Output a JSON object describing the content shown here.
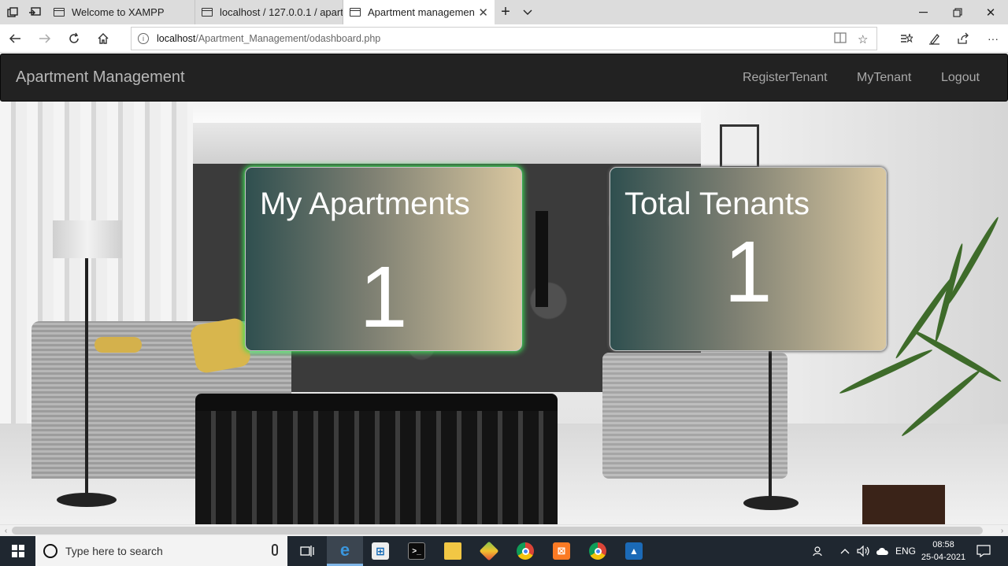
{
  "browser": {
    "tabs": [
      {
        "title": "Welcome to XAMPP",
        "active": false
      },
      {
        "title": "localhost / 127.0.0.1 / aparti",
        "active": false
      },
      {
        "title": "Apartment managemen",
        "active": true
      }
    ],
    "url": {
      "host": "localhost",
      "path": "/Apartment_Management/odashboard.php"
    },
    "icons": {
      "tab_actions": "tab-actions-icon",
      "back_tabs": "set-aside-tabs-icon",
      "new_tab": "plus-icon",
      "tab_list": "chevron-down-icon",
      "minimize": "minimize-icon",
      "maximize": "maximize-icon",
      "close": "close-icon"
    }
  },
  "navbar": {
    "brand": "Apartment Management",
    "links": [
      "RegisterTenant",
      "MyTenant",
      "Logout"
    ]
  },
  "dashboard": {
    "cards": [
      {
        "title": "My Apartments",
        "value": "1"
      },
      {
        "title": "Total Tenants",
        "value": "1"
      }
    ],
    "colors": {
      "card_gradient_start": "#2f4f4f",
      "card_gradient_end": "#d9c7a0",
      "highlight_glow": "#3ddc55"
    }
  },
  "taskbar": {
    "search_placeholder": "Type here to search",
    "language": "ENG",
    "time": "08:58",
    "date": "25-04-2021",
    "apps": [
      "task-view",
      "edge",
      "store",
      "terminal",
      "file-explorer",
      "bluestacks",
      "chrome",
      "xampp",
      "chrome-canary",
      "photos"
    ]
  }
}
